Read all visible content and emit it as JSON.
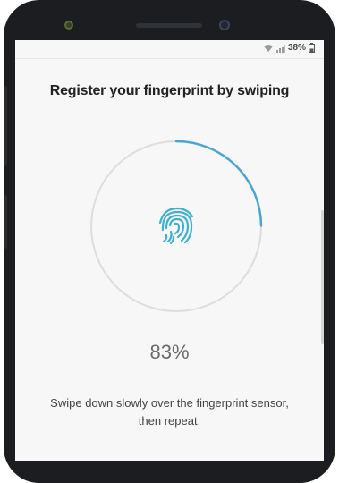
{
  "status_bar": {
    "battery_percent": "38%",
    "icons": [
      "wifi-icon",
      "signal-icon",
      "battery-icon"
    ]
  },
  "page": {
    "title": "Register your fingerprint by swiping",
    "progress_value": 83,
    "progress_text": "83%",
    "instruction": "Swipe down slowly over the fingerprint sensor, then repeat."
  },
  "colors": {
    "accent": "#4aa6d1",
    "ring_track": "#dddddd",
    "background": "#f7f7f7"
  }
}
